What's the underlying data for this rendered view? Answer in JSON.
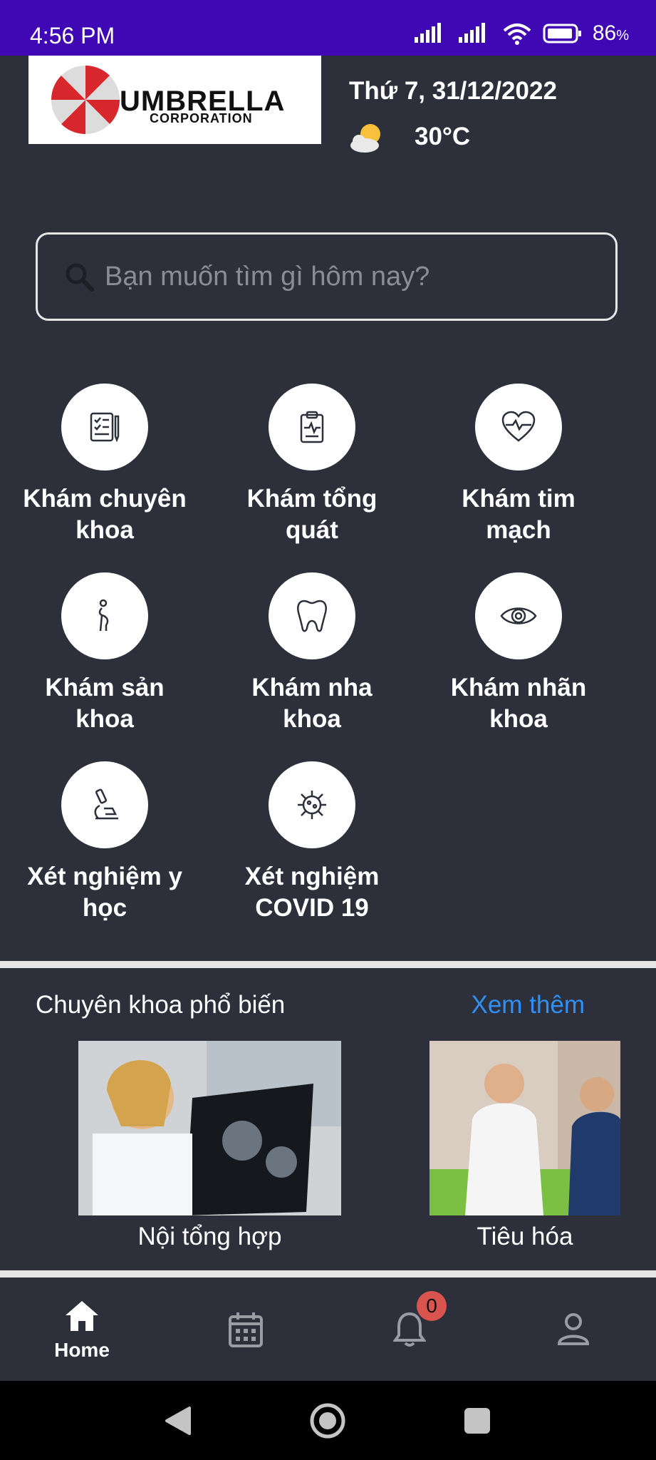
{
  "status_bar": {
    "time": "4:56 PM",
    "battery": "86",
    "battery_unit": "%"
  },
  "header": {
    "logo_name": "UMBRELLA",
    "logo_sub": "CORPORATION",
    "date": "Thứ 7, 31/12/2022",
    "temperature": "30°C",
    "weather_icon": "partly-sunny-icon"
  },
  "search": {
    "placeholder": "Bạn muốn tìm gì hôm nay?"
  },
  "services": [
    {
      "line1": "Khám chuyên",
      "line2": "khoa",
      "icon": "checklist-icon"
    },
    {
      "line1": "Khám tổng",
      "line2": "quát",
      "icon": "clipboard-pulse-icon"
    },
    {
      "line1": "Khám tim",
      "line2": "mạch",
      "icon": "heart-pulse-icon"
    },
    {
      "line1": "Khám sản",
      "line2": "khoa",
      "icon": "pregnant-icon"
    },
    {
      "line1": "Khám nha",
      "line2": "khoa",
      "icon": "tooth-icon"
    },
    {
      "line1": "Khám nhãn",
      "line2": "khoa",
      "icon": "eye-icon"
    },
    {
      "line1": "Xét nghiệm y",
      "line2": "học",
      "icon": "microscope-icon"
    },
    {
      "line1": "Xét nghiệm",
      "line2": "COVID 19",
      "icon": "virus-icon"
    }
  ],
  "popular": {
    "title": "Chuyên khoa phổ biến",
    "more": "Xem thêm",
    "items": [
      {
        "label": "Nội tổng hợp"
      },
      {
        "label": "Tiêu hóa"
      }
    ]
  },
  "bottom_nav": {
    "home_label": "Home",
    "notification_count": "0"
  },
  "colors": {
    "status_bar": "#3f08b4",
    "background": "#2d303b",
    "link": "#2f90f5",
    "badge": "#d9534f"
  }
}
